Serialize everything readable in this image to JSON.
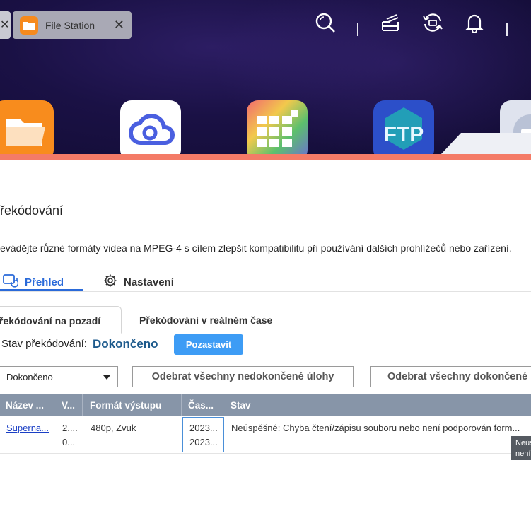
{
  "browser_tab": {
    "title": "File Station",
    "close_glyph": "✕",
    "prev_tab_close_glyph": "✕"
  },
  "top_icons": [
    "search-icon",
    "tasks-icon",
    "sync-icon",
    "bell-icon"
  ],
  "apps": [
    "file-station-icon",
    "cloud-icon",
    "app-center-icon",
    "ftp-icon",
    "lock-icon"
  ],
  "page": {
    "title": "řekódování",
    "description": "evádějte různé formáty videa na MPEG-4 s cílem zlepšit kompatibilitu při používání dalších prohlížečů nebo zařízení."
  },
  "main_tabs": {
    "overview": "Přehled",
    "settings": "Nastavení"
  },
  "sub_tabs": {
    "background": "řekódování na pozadí",
    "realtime": "Překódování v reálném čase"
  },
  "status": {
    "label": "Stav překódování:",
    "value": "Dokončeno",
    "pause_button": "Pozastavit"
  },
  "filter": {
    "selected": "Dokončeno"
  },
  "actions": {
    "remove_unfinished": "Odebrat všechny nedokončené úlohy",
    "remove_finished": "Odebrat všechny dokončené"
  },
  "table": {
    "columns": [
      "Název ...",
      "V...",
      "Formát výstupu",
      "Čas...",
      "Stav"
    ],
    "rows": [
      {
        "name": "Superna...",
        "v_line1": "2....",
        "v_line2": "0...",
        "format": "480p, Zvuk",
        "time_line1": "2023...",
        "time_line2": "2023...",
        "status": "Neúspěšné: Chyba čtení/zápisu souboru nebo není podporován form..."
      }
    ]
  },
  "tooltip": {
    "line1": "Neúspěšn",
    "line2": "není podp"
  },
  "colors": {
    "accent": "#2a6ad9",
    "status_value": "#1d5a8c",
    "pause_button": "#3d9cf5",
    "table_header": "#8795a8",
    "accent_bar": "#f47b67"
  }
}
